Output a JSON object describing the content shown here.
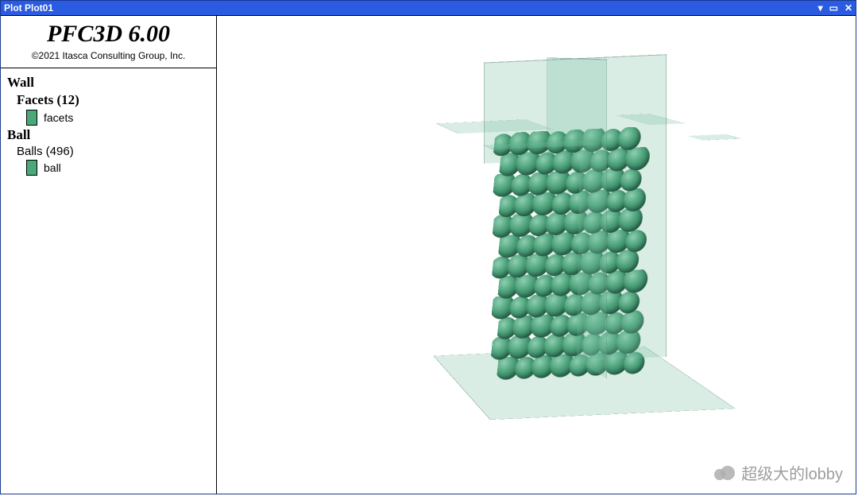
{
  "window": {
    "title": "Plot Plot01"
  },
  "header": {
    "app_title": "PFC3D 6.00",
    "copyright": "©2021 Itasca Consulting Group, Inc."
  },
  "legend": {
    "wall": {
      "heading": "Wall",
      "facets_heading": "Facets (12)",
      "facets_count": 12,
      "facets_label": "facets",
      "facets_color": "#4aa879"
    },
    "ball": {
      "heading": "Ball",
      "balls_heading": "Balls (496)",
      "balls_count": 496,
      "ball_label": "ball",
      "ball_color": "#4aa879"
    }
  },
  "watermark": {
    "text": "超级大的lobby"
  },
  "viewport": {
    "object_description": "Rectangular packing of green spheres enclosed by six translucent green wall facets",
    "approx_ball_rows": 12,
    "approx_ball_cols": 8
  }
}
